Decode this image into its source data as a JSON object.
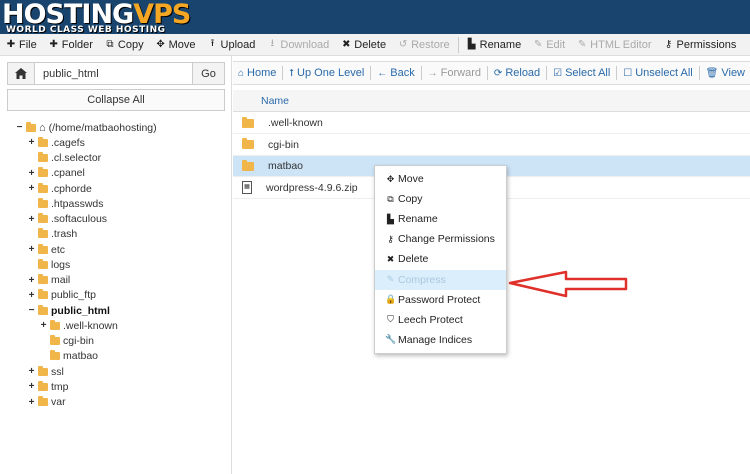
{
  "brand": {
    "logo_main": "HOSTING",
    "logo_accent": "VPS",
    "tagline": "WORLD CLASS WEB HOSTING"
  },
  "toolbar": {
    "items": [
      {
        "label": "File",
        "icon": "plus-icon",
        "glyph": "✚",
        "disabled": false
      },
      {
        "label": "Folder",
        "icon": "plus-icon",
        "glyph": "✚",
        "disabled": false
      },
      {
        "label": "Copy",
        "icon": "copy-icon",
        "glyph": "⧉",
        "disabled": false
      },
      {
        "label": "Move",
        "icon": "move-icon",
        "glyph": "✥",
        "disabled": false
      },
      {
        "label": "Upload",
        "icon": "upload-icon",
        "glyph": "⭱",
        "disabled": false
      },
      {
        "label": "Download",
        "icon": "download-icon",
        "glyph": "⭳",
        "disabled": true
      },
      {
        "label": "Delete",
        "icon": "delete-icon",
        "glyph": "✖",
        "disabled": false
      },
      {
        "label": "Restore",
        "icon": "restore-icon",
        "glyph": "↺",
        "disabled": true
      },
      {
        "label": "Rename",
        "icon": "rename-icon",
        "glyph": "▙",
        "disabled": false
      },
      {
        "label": "Edit",
        "icon": "edit-icon",
        "glyph": "✎",
        "disabled": true
      },
      {
        "label": "HTML Editor",
        "icon": "html-editor-icon",
        "glyph": "✎",
        "disabled": true
      },
      {
        "label": "Permissions",
        "icon": "key-icon",
        "glyph": "⚷",
        "disabled": false
      }
    ]
  },
  "left": {
    "path_value": "public_html",
    "go_label": "Go",
    "collapse_label": "Collapse All",
    "tree": [
      {
        "label": "(/home/matbaohosting)",
        "toggle": "−",
        "level": 0,
        "icon": "home",
        "bold": false
      },
      {
        "label": ".cagefs",
        "toggle": "+",
        "level": 1,
        "icon": "folder",
        "bold": false
      },
      {
        "label": ".cl.selector",
        "toggle": "",
        "level": 1,
        "icon": "folder",
        "bold": false
      },
      {
        "label": ".cpanel",
        "toggle": "+",
        "level": 1,
        "icon": "folder",
        "bold": false
      },
      {
        "label": ".cphorde",
        "toggle": "+",
        "level": 1,
        "icon": "folder",
        "bold": false
      },
      {
        "label": ".htpasswds",
        "toggle": "",
        "level": 1,
        "icon": "folder",
        "bold": false
      },
      {
        "label": ".softaculous",
        "toggle": "+",
        "level": 1,
        "icon": "folder",
        "bold": false
      },
      {
        "label": ".trash",
        "toggle": "",
        "level": 1,
        "icon": "folder",
        "bold": false
      },
      {
        "label": "etc",
        "toggle": "+",
        "level": 1,
        "icon": "folder",
        "bold": false
      },
      {
        "label": "logs",
        "toggle": "",
        "level": 1,
        "icon": "folder",
        "bold": false
      },
      {
        "label": "mail",
        "toggle": "+",
        "level": 1,
        "icon": "folder",
        "bold": false
      },
      {
        "label": "public_ftp",
        "toggle": "+",
        "level": 1,
        "icon": "folder",
        "bold": false
      },
      {
        "label": "public_html",
        "toggle": "−",
        "level": 1,
        "icon": "folder",
        "bold": true
      },
      {
        "label": ".well-known",
        "toggle": "+",
        "level": 2,
        "icon": "folder",
        "bold": false
      },
      {
        "label": "cgi-bin",
        "toggle": "",
        "level": 2,
        "icon": "folder",
        "bold": false
      },
      {
        "label": "matbao",
        "toggle": "",
        "level": 2,
        "icon": "folder",
        "bold": false
      },
      {
        "label": "ssl",
        "toggle": "+",
        "level": 1,
        "icon": "folder",
        "bold": false
      },
      {
        "label": "tmp",
        "toggle": "+",
        "level": 1,
        "icon": "folder",
        "bold": false
      },
      {
        "label": "var",
        "toggle": "+",
        "level": 1,
        "icon": "folder",
        "bold": false
      }
    ]
  },
  "nav": {
    "items": [
      {
        "label": "Home",
        "glyph": "⌂",
        "icon": "home-icon",
        "disabled": false
      },
      {
        "label": "Up One Level",
        "glyph": "⭡",
        "icon": "up-icon",
        "disabled": false
      },
      {
        "label": "Back",
        "glyph": "←",
        "icon": "back-icon",
        "disabled": false
      },
      {
        "label": "Forward",
        "glyph": "→",
        "icon": "forward-icon",
        "disabled": true
      },
      {
        "label": "Reload",
        "glyph": "⟳",
        "icon": "reload-icon",
        "disabled": false
      },
      {
        "label": "Select All",
        "glyph": "☑",
        "icon": "select-all-icon",
        "disabled": false
      },
      {
        "label": "Unselect All",
        "glyph": "☐",
        "icon": "unselect-all-icon",
        "disabled": false
      },
      {
        "label": "View",
        "glyph": "🗑",
        "icon": "trash-icon",
        "disabled": false
      }
    ]
  },
  "list": {
    "header_name": "Name",
    "rows": [
      {
        "name": ".well-known",
        "type": "folder",
        "selected": false
      },
      {
        "name": "cgi-bin",
        "type": "folder",
        "selected": false
      },
      {
        "name": "matbao",
        "type": "folder",
        "selected": true
      },
      {
        "name": "wordpress-4.9.6.zip",
        "type": "zip",
        "selected": false
      }
    ]
  },
  "context_menu": {
    "items": [
      {
        "label": "Move",
        "glyph": "✥",
        "icon": "move-icon",
        "hover": false
      },
      {
        "label": "Copy",
        "glyph": "⧉",
        "icon": "copy-icon",
        "hover": false
      },
      {
        "label": "Rename",
        "glyph": "▙",
        "icon": "rename-icon",
        "hover": false
      },
      {
        "label": "Change Permissions",
        "glyph": "⚷",
        "icon": "key-icon",
        "hover": false
      },
      {
        "label": "Delete",
        "glyph": "✖",
        "icon": "delete-icon",
        "hover": false
      },
      {
        "label": "Compress",
        "glyph": "✎",
        "icon": "compress-icon",
        "hover": true
      },
      {
        "label": "Password Protect",
        "glyph": "🔒",
        "icon": "lock-icon",
        "hover": false
      },
      {
        "label": "Leech Protect",
        "glyph": "⛉",
        "icon": "shield-icon",
        "hover": false
      },
      {
        "label": "Manage Indices",
        "glyph": "🔧",
        "icon": "wrench-icon",
        "hover": false
      }
    ]
  },
  "colors": {
    "header_bg": "#18446e",
    "link": "#2a6aaa",
    "arrow": "#e0302a",
    "selected_row": "#cde4f7",
    "folder": "#f0b64a"
  }
}
